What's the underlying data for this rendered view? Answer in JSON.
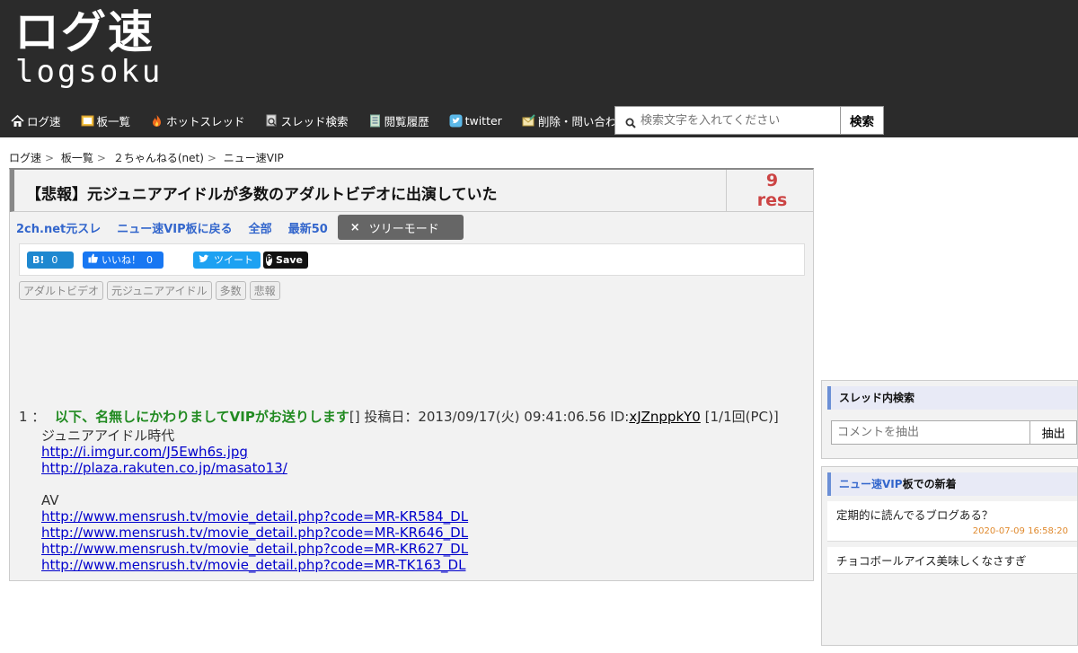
{
  "header": {
    "logo_jp": "ログ速",
    "logo_en": "logsoku"
  },
  "nav": [
    {
      "label": "ログ速",
      "icon": "home-icon"
    },
    {
      "label": "板一覧",
      "icon": "board-icon"
    },
    {
      "label": "ホットスレッド",
      "icon": "fire-icon"
    },
    {
      "label": "スレッド検索",
      "icon": "thread-search-icon"
    },
    {
      "label": "閲覧履歴",
      "icon": "history-icon"
    },
    {
      "label": "twitter",
      "icon": "twitter-icon"
    },
    {
      "label": "削除・問い合わせ",
      "icon": "mail-icon"
    }
  ],
  "search": {
    "placeholder": "検索文字を入れてください",
    "button_label": "検索"
  },
  "breadcrumb": [
    "ログ速",
    "板一覧",
    "２ちゃんねる(net)",
    "ニュー速VIP"
  ],
  "thread": {
    "title": "【悲報】元ジュニアアイドルが多数のアダルトビデオに出演していた",
    "res_count": "9",
    "res_label": "res",
    "links": [
      "2ch.net元スレ",
      "ニュー速VIP板に戻る",
      "全部",
      "最新50"
    ],
    "tree_mode_label": "ツリーモード",
    "tree_close": "×"
  },
  "share": {
    "hatena_label": "B!",
    "hatena_count": "0",
    "fb_label": "いいね！",
    "fb_count": "0",
    "tweet_label": "ツイート",
    "pin_label": "Save"
  },
  "tags": [
    "アダルトビデオ",
    "元ジュニアアイドル",
    "多数",
    "悲報"
  ],
  "post": {
    "number": "1 ：",
    "name": "以下、名無しにかわりましてVIPがお送りします",
    "mail": "[]",
    "date": "投稿日：2013/09/17(火) 09:41:06.56",
    "id_label": "ID:",
    "id": "xJZnppkY0",
    "count": "[1/1回(PC)]",
    "body_line1": "ジュニアアイドル時代",
    "links1": [
      "http://i.imgur.com/J5Ewh6s.jpg",
      "http://plaza.rakuten.co.jp/masato13/"
    ],
    "body_line2": "AV",
    "links2": [
      "http://www.mensrush.tv/movie_detail.php?code=MR-KR584_DL",
      "http://www.mensrush.tv/movie_detail.php?code=MR-KR646_DL",
      "http://www.mensrush.tv/movie_detail.php?code=MR-KR627_DL",
      "http://www.mensrush.tv/movie_detail.php?code=MR-TK163_DL"
    ]
  },
  "sidebar": {
    "search_title": "スレッド内検索",
    "comment_placeholder": "コメントを抽出",
    "extract_label": "抽出",
    "new_title_board": "ニュー速VIP",
    "new_title_suffix": "板での新着",
    "new_items": [
      {
        "title": "定期的に読んでるブログある？",
        "date": "2020-07-09 16:58:20"
      },
      {
        "title": "チョコボールアイス美味しくなさすぎ",
        "date": ""
      }
    ]
  },
  "colors": {
    "header_bg": "#2b2b2b",
    "link_blue": "#3366cc",
    "name_green": "#228b22",
    "res_red": "#cc4444"
  }
}
